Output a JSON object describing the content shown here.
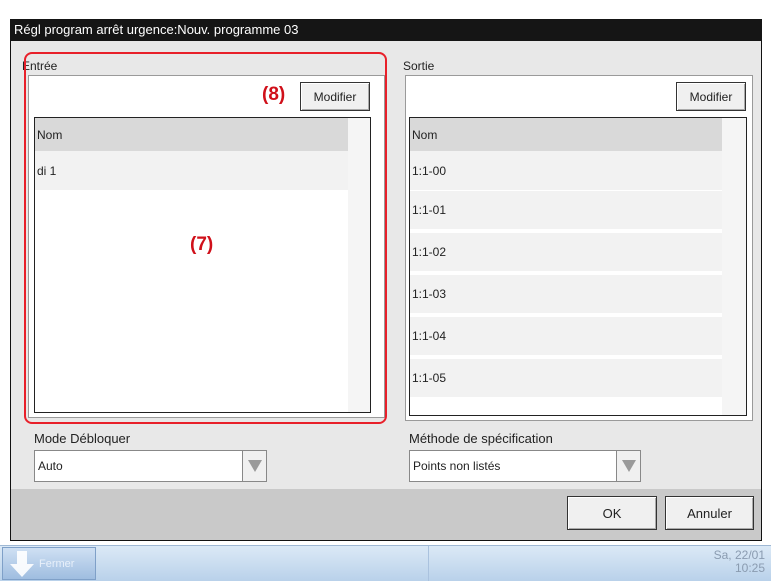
{
  "window": {
    "title": "Régl program arrêt urgence:Nouv. programme 03"
  },
  "input_panel": {
    "label": "Entrée",
    "modify_label": "Modifier",
    "list_header": "Nom",
    "rows": [
      "di 1"
    ]
  },
  "output_panel": {
    "label": "Sortie",
    "modify_label": "Modifier",
    "list_header": "Nom",
    "rows": [
      "1:1-00",
      "1:1-01",
      "1:1-02",
      "1:1-03",
      "1:1-04",
      "1:1-05"
    ]
  },
  "unlock_mode": {
    "label": "Mode Débloquer",
    "value": "Auto"
  },
  "spec_method": {
    "label": "Méthode de spécification",
    "value": "Points non listés"
  },
  "footer": {
    "ok_label": "OK",
    "cancel_label": "Annuler"
  },
  "annotations": {
    "list_marker": "(7)",
    "button_marker": "(8)"
  },
  "taskbar": {
    "left_label": "Fermer",
    "date": "Sa, 22/01",
    "time": "10:25"
  },
  "icons": {
    "dropdown": "triangle-down-icon",
    "taskbar_left": "down-arrow-icon"
  },
  "colors": {
    "titlebar": "#151515",
    "dialog_bg": "#e8e8e8",
    "annotation": "#e8202a",
    "taskbar": "#c8dcf0"
  }
}
